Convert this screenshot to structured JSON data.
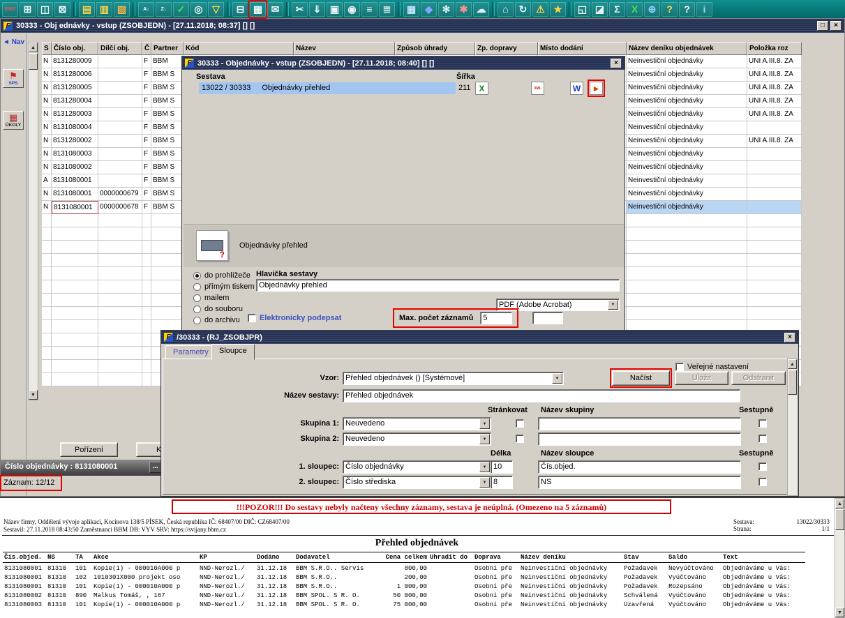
{
  "annotation_color": "#e80000",
  "toolbar": {
    "icons": [
      {
        "name": "exit-icon",
        "glyph": "EXIT",
        "fg": "#ff5050",
        "small": true
      },
      {
        "name": "insert-record-icon",
        "glyph": "⊞",
        "fg": "#e8f4f4"
      },
      {
        "name": "copy-record-icon",
        "glyph": "◫",
        "fg": "#e8f4f4"
      },
      {
        "name": "delete-record-icon",
        "glyph": "⊠",
        "fg": "#e8f4f4"
      },
      {
        "sep": true
      },
      {
        "name": "open-folder-icon",
        "glyph": "▤",
        "fg": "#f2d24b"
      },
      {
        "name": "copy-folder-icon",
        "glyph": "▥",
        "fg": "#f2d24b"
      },
      {
        "name": "delete-folder-icon",
        "glyph": "▧",
        "fg": "#f2b24b"
      },
      {
        "sep": true
      },
      {
        "name": "sort-asc-icon",
        "glyph": "A↓",
        "fg": "#ffffff",
        "small": true
      },
      {
        "name": "sort-desc-icon",
        "glyph": "Z↓",
        "fg": "#ffffff",
        "small": true
      },
      {
        "name": "confirm-icon",
        "glyph": "✓",
        "fg": "#4fe04f"
      },
      {
        "name": "search-icon",
        "glyph": "◎",
        "fg": "#e8f4f4"
      },
      {
        "name": "filter-icon",
        "glyph": "▽",
        "fg": "#f2d24b"
      },
      {
        "sep": true
      },
      {
        "name": "print-icon",
        "glyph": "⊟",
        "fg": "#e8f4f4"
      },
      {
        "name": "print-report-icon",
        "glyph": "▦",
        "fg": "#e8f4f4",
        "annotated": true
      },
      {
        "name": "mail-icon",
        "glyph": "✉",
        "fg": "#e8f4f4"
      },
      {
        "sep": true
      },
      {
        "name": "cut-icon",
        "glyph": "✂",
        "fg": "#e8f4f4"
      },
      {
        "name": "paste-icon",
        "glyph": "⇓",
        "fg": "#e8f4f4"
      },
      {
        "name": "copy-pages-icon",
        "glyph": "▣",
        "fg": "#e8f4f4"
      },
      {
        "name": "zoom-icon",
        "glyph": "◉",
        "fg": "#e8f4f4"
      },
      {
        "name": "list-icon",
        "glyph": "≡",
        "fg": "#e8f4f4"
      },
      {
        "name": "columns-icon",
        "glyph": "≣",
        "fg": "#e8f4f4"
      },
      {
        "sep": true
      },
      {
        "name": "calendar-icon",
        "glyph": "▦",
        "fg": "#bfe0ff"
      },
      {
        "name": "save-icon",
        "glyph": "◆",
        "fg": "#7ea8ff"
      },
      {
        "name": "settings-icon",
        "glyph": "✻",
        "fg": "#e8f4f4"
      },
      {
        "name": "bug-icon",
        "glyph": "✱",
        "fg": "#ff9090"
      },
      {
        "name": "cloud-icon",
        "glyph": "☁",
        "fg": "#dff2ff"
      },
      {
        "sep": true
      },
      {
        "name": "home-icon",
        "glyph": "⌂",
        "fg": "#e8f4f4"
      },
      {
        "name": "refresh-icon",
        "glyph": "↻",
        "fg": "#e8f4f4"
      },
      {
        "name": "warning-icon",
        "glyph": "⚠",
        "fg": "#ffd24b"
      },
      {
        "name": "star-icon",
        "glyph": "★",
        "fg": "#ffd24b"
      },
      {
        "sep": true
      },
      {
        "name": "window-icon",
        "glyph": "◱",
        "fg": "#e8f4f4"
      },
      {
        "name": "chart-icon",
        "glyph": "◪",
        "fg": "#e8f4f4"
      },
      {
        "name": "sigma-icon",
        "glyph": "Σ",
        "fg": "#e8f4f4"
      },
      {
        "name": "excel-icon",
        "glyph": "X",
        "fg": "#4fe04f"
      },
      {
        "name": "globe-icon",
        "glyph": "⊕",
        "fg": "#8fd0ff"
      },
      {
        "name": "help-book-icon",
        "glyph": "?",
        "fg": "#ffd24b"
      },
      {
        "name": "question-icon",
        "glyph": "?",
        "fg": "#ffffff"
      },
      {
        "name": "info-icon",
        "glyph": "i",
        "fg": "#9fd8ff"
      }
    ]
  },
  "main_window": {
    "title": "30333 - Obj ednávky - vstup (ZSOBJEDN) - [27.11.2018; 08:37]  []  []",
    "restore_glyph": "□",
    "close_glyph": "×"
  },
  "sidebar": {
    "nav_arrow": "◄",
    "nav_label": "Nav",
    "items": [
      {
        "name": "sps",
        "glyph": "⚑",
        "label": "SPS"
      },
      {
        "name": "ukoly",
        "glyph": "▦",
        "label": "ÚKOLY"
      }
    ]
  },
  "grid": {
    "headers": {
      "s": "S",
      "cislo": "Číslo obj.",
      "dilci": "Dílčí obj.",
      "c": "Č",
      "partner": "Partner",
      "kod": "Kód",
      "nazev": "Název",
      "uhrada": "Způsob úhrady",
      "doprava": "Zp. dopravy",
      "misto": "Místo dodání",
      "denik": "Název deníku objednávek",
      "polozka": "Položka roz"
    },
    "rows": [
      {
        "s": "N",
        "cislo": "8131280009",
        "dilci": "",
        "c": "F",
        "partner": "BBM",
        "denik": "Neinvestiční objednávky",
        "polozka": "UNI A.III.8. ZA"
      },
      {
        "s": "N",
        "cislo": "8131280006",
        "dilci": "",
        "c": "F",
        "partner": "BBM S",
        "denik": "Neinvestiční objednávky",
        "polozka": "UNI A.III.8. ZA"
      },
      {
        "s": "N",
        "cislo": "8131280005",
        "dilci": "",
        "c": "F",
        "partner": "BBM S",
        "denik": "Neinvestiční objednávky",
        "polozka": "UNI A.III.8. ZA"
      },
      {
        "s": "N",
        "cislo": "8131280004",
        "dilci": "",
        "c": "F",
        "partner": "BBM S",
        "denik": "Neinvestiční objednávky",
        "polozka": "UNI A.III.8. ZA"
      },
      {
        "s": "N",
        "cislo": "8131280003",
        "dilci": "",
        "c": "F",
        "partner": "BBM S",
        "denik": "Neinvestiční objednávky",
        "polozka": "UNI A.III.8. ZA"
      },
      {
        "s": "N",
        "cislo": "8131080004",
        "dilci": "",
        "c": "F",
        "partner": "BBM S",
        "denik": "Neinvestiční objednávky",
        "polozka": ""
      },
      {
        "s": "N",
        "cislo": "8131280002",
        "dilci": "",
        "c": "F",
        "partner": "BBM S",
        "denik": "Neinvestiční objednávky",
        "polozka": "UNI A.III.8. ZA"
      },
      {
        "s": "N",
        "cislo": "8131080003",
        "dilci": "",
        "c": "F",
        "partner": "BBM S",
        "denik": "Neinvestiční objednávky",
        "polozka": ""
      },
      {
        "s": "N",
        "cislo": "8131080002",
        "dilci": "",
        "c": "F",
        "partner": "BBM S",
        "denik": "Neinvestiční objednávky",
        "polozka": ""
      },
      {
        "s": "A",
        "cislo": "8131080001",
        "dilci": "",
        "c": "F",
        "partner": "BBM S",
        "denik": "Neinvestiční objednávky",
        "polozka": ""
      },
      {
        "s": "N",
        "cislo": "8131080001",
        "dilci": "0000000679",
        "c": "F",
        "partner": "BBM S",
        "denik": "Neinvestiční objednávky",
        "polozka": ""
      },
      {
        "s": "N",
        "cislo": "8131080001",
        "dilci": "0000000678",
        "c": "F",
        "partner": "BBM S",
        "denik": "Neinvestiční objednávky",
        "polozka": "",
        "selected": true
      }
    ]
  },
  "print_dialog": {
    "title": "30333 - Objednávky - vstup (ZSOBJEDN) - [27.11.2018; 08:40]  []  []",
    "sestava_label": "Sestava",
    "sirka_label": "Šířka",
    "report_id": "13022 / 30333",
    "report_name": "Objednávky přehled",
    "report_width": "211",
    "icons": [
      {
        "name": "excel-export-icon",
        "glyph": "X",
        "fg": "#1a7d32"
      },
      {
        "name": "xml-export-icon",
        "glyph": "XML",
        "fg": "#cc2200",
        "small": true
      },
      {
        "name": "word-export-icon",
        "glyph": "W",
        "fg": "#1a3fbb"
      },
      {
        "name": "viewer-export-icon",
        "glyph": "►",
        "fg": "#cc4400",
        "annotated": true
      }
    ],
    "preview_name": "Objednávky přehled",
    "radios": [
      {
        "label": "do prohlížeče",
        "checked": true
      },
      {
        "label": "přímým tiskem"
      },
      {
        "label": "mailem"
      },
      {
        "label": "do souboru"
      },
      {
        "label": "do archivu"
      }
    ],
    "header_label": "Hlavička sestavy",
    "header_value": "Objednávky přehled",
    "format_value": "PDF (Adobe Acrobat)",
    "sign_label": "Elektronicky podepsat",
    "max_records_label": "Max. počet záznamů",
    "max_records_value": "5",
    "extra_value": ""
  },
  "columns_dialog": {
    "title": "/30333 - (RJ_ZSOBJPR)",
    "tabs": [
      {
        "label": "Parametry"
      },
      {
        "label": "Sloupce",
        "active": true
      }
    ],
    "public_label": "Veřejné nastavení",
    "vzor_label": "Vzor:",
    "vzor_value": "Přehled objednávek  ()  [Systémové]",
    "buttons": {
      "nacist": "Načíst",
      "ulozit": "Uložit",
      "odstranit": "Odstranit"
    },
    "nazev_label": "Název sestavy:",
    "nazev_value": "Přehled objednávek",
    "group_headers": {
      "strankovat": "Stránkovat",
      "nazev_skupiny": "Název skupiny",
      "sestupne": "Sestupně"
    },
    "groups": [
      {
        "label": "Skupina 1:",
        "value": "Neuvedeno"
      },
      {
        "label": "Skupina 2:",
        "value": "Neuvedeno"
      }
    ],
    "col_headers": {
      "delka": "Délka",
      "nazev_sloupce": "Název sloupce",
      "sestupne": "Sestupně"
    },
    "columns": [
      {
        "label": "1. sloupec:",
        "value": "Číslo objednávky",
        "delka": "10",
        "nazev": "Čís.objed."
      },
      {
        "label": "2. sloupec:",
        "value": "Číslo střediska",
        "delka": "8",
        "nazev": "NS"
      }
    ]
  },
  "footer": {
    "porizeni_button": "Pořízení",
    "kopie_button": "Kopi",
    "record_label": "Číslo objednávky : 8131080001",
    "dots_button": "...",
    "zaznam_label": "Záznam: 12/12"
  },
  "report": {
    "warning": "!!!POZOR!!! Do sestavy nebyly načteny všechny záznamy, sestava je neúplná. (Omezeno na 5 záznamů)",
    "company_line": "Název firmy, Oddělení vývoje aplikací, Kocinova 138/5 PÍSEK, Česká republika  IČ: 68407/00  DIČ: CZ68407/00",
    "created_line": "Sestavil: 27.11.2018 08:43:50 Zaměstnanci BBM  DB: VYV  SRV: https://svijany.bbm.cz",
    "sestava_label": "Sestava:",
    "sestava_value": "13022/30333",
    "strana_label": "Strana:",
    "strana_value": "1/1",
    "title": "Přehled objednávek",
    "table": {
      "headers": [
        "Čís.objed.",
        "NS",
        "TA",
        "Akce",
        "KP",
        "Dodáno",
        "Dodavatel",
        "Cena celkem",
        "Uhradit do",
        "Doprava",
        "Název deníku",
        "Stav",
        "Saldo",
        "Text"
      ],
      "rows": [
        [
          "8131080001",
          "81310",
          "101",
          "Kopie(1) - 000010A000 p",
          "NND-Nerozl./",
          "31.12.18",
          "BBM S.R.O.. Servis",
          "800,00",
          "",
          "Osobní pře",
          "Neinvestiční objednávky",
          "Požadavek",
          "Nevyúčtováno",
          "Objednáváme u Vás:"
        ],
        [
          "8131080001",
          "81310",
          "102",
          "1010301X000 projekt oso",
          "NND-Nerozl./",
          "31.12.18",
          "BBM S.R.O..",
          "200,00",
          "",
          "Osobní pře",
          "Neinvestiční objednávky",
          "Požadavek",
          "Vyúčtováno",
          "Objednáváme u Vás:"
        ],
        [
          "8131080001",
          "81310",
          "101",
          "Kopie(1) - 000010A000 p",
          "NND-Nerozl./",
          "31.12.18",
          "BBM S.R.O..",
          "1 000,00",
          "",
          "Osobní pře",
          "Neinvestiční objednávky",
          "Požadavek",
          "Rozepsáno",
          "Objednáváme u Vás:"
        ],
        [
          "8131080002",
          "81310",
          "890",
          "Malkus Tomáš, , 167",
          "NND-Nerozl./",
          "31.12.18",
          "BBM SPOL. S R. O.",
          "50 000,00",
          "",
          "Osobní pře",
          "Neinvestiční objednávky",
          "Schválená",
          "Vyúčtováno",
          "Objednáváme u Vás:"
        ],
        [
          "8131080003",
          "81310",
          "101",
          "Kopie(1) - 000010A000 p",
          "NND-Nerozl./",
          "31.12.18",
          "BBM SPOL. S R. O.",
          "75 000,00",
          "",
          "Osobní pře",
          "Neinvestiční objednávky",
          "Uzavřená",
          "Vyúčtováno",
          "Objednáváme u Vás:"
        ]
      ]
    }
  }
}
